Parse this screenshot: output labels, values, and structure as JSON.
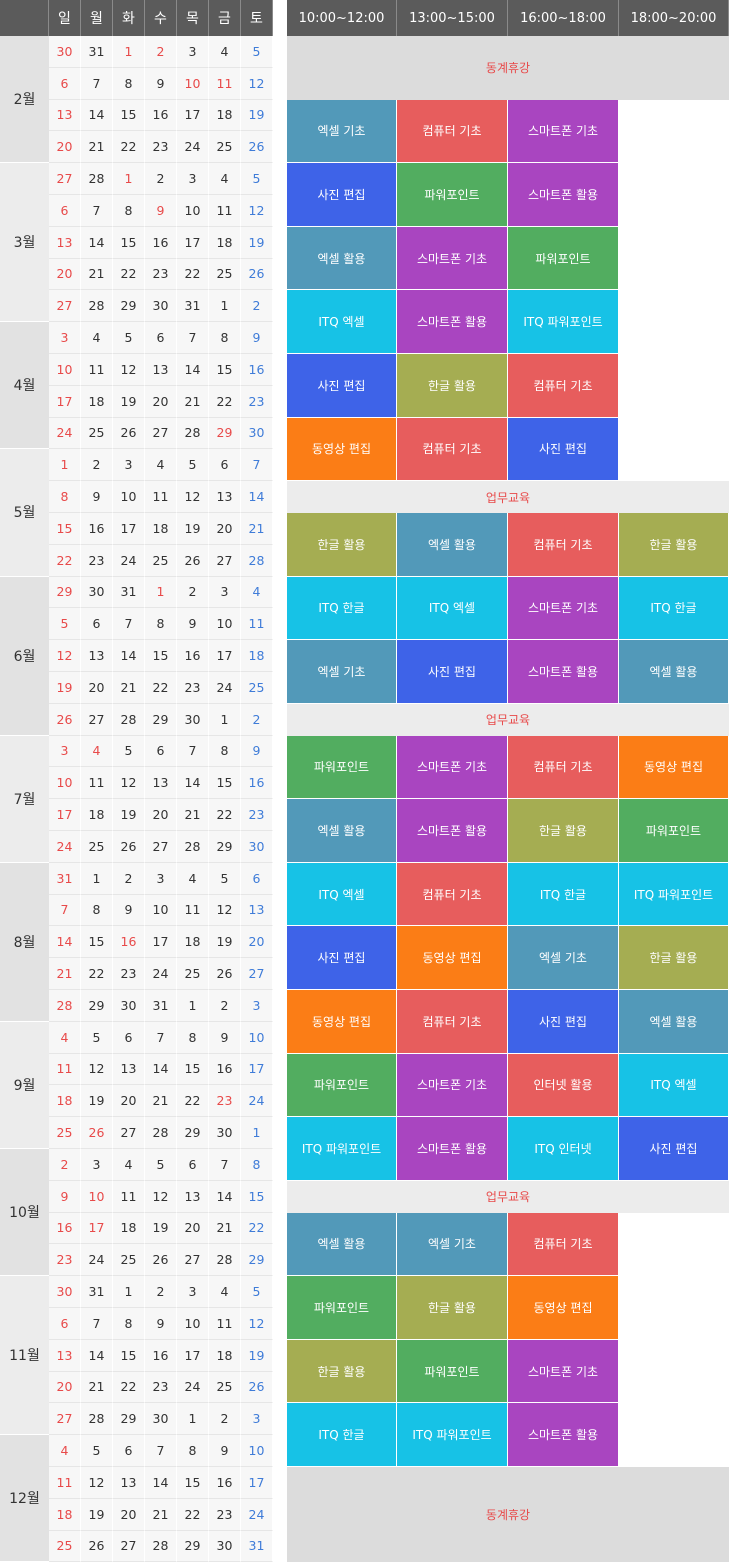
{
  "weekdays": [
    "일",
    "월",
    "화",
    "수",
    "목",
    "금",
    "토"
  ],
  "slots": [
    "10:00~12:00",
    "13:00~15:00",
    "16:00~18:00",
    "18:00~20:00"
  ],
  "colors": {
    "엑셀 기초": "#5299b9",
    "엑셀 활용": "#5299b9",
    "컴퓨터 기초": "#e75d5d",
    "인터넷 활용": "#e75d5d",
    "스마트폰 기초": "#a945c0",
    "스마트폰 활용": "#a945c0",
    "사진 편집": "#3e63e8",
    "파워포인트": "#52ad60",
    "ITQ 엑셀": "#17c2e6",
    "ITQ 파워포인트": "#17c2e6",
    "ITQ 한글": "#17c2e6",
    "ITQ 인터넷": "#17c2e6",
    "한글 활용": "#a5ad52",
    "동영상 편집": "#fb7d16"
  },
  "months": [
    {
      "label": "2월",
      "weeks": [
        [
          "30",
          "31",
          "1",
          "2",
          "3",
          "4",
          "5"
        ],
        [
          "6",
          "7",
          "8",
          "9",
          "10",
          "11",
          "12"
        ],
        [
          "13",
          "14",
          "15",
          "16",
          "17",
          "18",
          "19"
        ],
        [
          "20",
          "21",
          "22",
          "23",
          "24",
          "25",
          "26"
        ]
      ]
    },
    {
      "label": "3월",
      "weeks": [
        [
          "27",
          "28",
          "1",
          "2",
          "3",
          "4",
          "5"
        ],
        [
          "6",
          "7",
          "8",
          "9",
          "10",
          "11",
          "12"
        ],
        [
          "13",
          "14",
          "15",
          "16",
          "17",
          "18",
          "19"
        ],
        [
          "20",
          "21",
          "22",
          "23",
          "22",
          "25",
          "26"
        ],
        [
          "27",
          "28",
          "29",
          "30",
          "31",
          "1",
          "2"
        ]
      ]
    },
    {
      "label": "4월",
      "weeks": [
        [
          "3",
          "4",
          "5",
          "6",
          "7",
          "8",
          "9"
        ],
        [
          "10",
          "11",
          "12",
          "13",
          "14",
          "15",
          "16"
        ],
        [
          "17",
          "18",
          "19",
          "20",
          "21",
          "22",
          "23"
        ],
        [
          "24",
          "25",
          "26",
          "27",
          "28",
          "29",
          "30"
        ]
      ]
    },
    {
      "label": "5월",
      "weeks": [
        [
          "1",
          "2",
          "3",
          "4",
          "5",
          "6",
          "7"
        ],
        [
          "8",
          "9",
          "10",
          "11",
          "12",
          "13",
          "14"
        ],
        [
          "15",
          "16",
          "17",
          "18",
          "19",
          "20",
          "21"
        ],
        [
          "22",
          "23",
          "24",
          "25",
          "26",
          "27",
          "28"
        ]
      ]
    },
    {
      "label": "6월",
      "weeks": [
        [
          "29",
          "30",
          "31",
          "1",
          "2",
          "3",
          "4"
        ],
        [
          "5",
          "6",
          "7",
          "8",
          "9",
          "10",
          "11"
        ],
        [
          "12",
          "13",
          "14",
          "15",
          "16",
          "17",
          "18"
        ],
        [
          "19",
          "20",
          "21",
          "22",
          "23",
          "24",
          "25"
        ],
        [
          "26",
          "27",
          "28",
          "29",
          "30",
          "1",
          "2"
        ]
      ]
    },
    {
      "label": "7월",
      "weeks": [
        [
          "3",
          "4",
          "5",
          "6",
          "7",
          "8",
          "9"
        ],
        [
          "10",
          "11",
          "12",
          "13",
          "14",
          "15",
          "16"
        ],
        [
          "17",
          "18",
          "19",
          "20",
          "21",
          "22",
          "23"
        ],
        [
          "24",
          "25",
          "26",
          "27",
          "28",
          "29",
          "30"
        ]
      ]
    },
    {
      "label": "8월",
      "weeks": [
        [
          "31",
          "1",
          "2",
          "3",
          "4",
          "5",
          "6"
        ],
        [
          "7",
          "8",
          "9",
          "10",
          "11",
          "12",
          "13"
        ],
        [
          "14",
          "15",
          "16",
          "17",
          "18",
          "19",
          "20"
        ],
        [
          "21",
          "22",
          "23",
          "24",
          "25",
          "26",
          "27"
        ],
        [
          "28",
          "29",
          "30",
          "31",
          "1",
          "2",
          "3"
        ]
      ]
    },
    {
      "label": "9월",
      "weeks": [
        [
          "4",
          "5",
          "6",
          "7",
          "8",
          "9",
          "10"
        ],
        [
          "11",
          "12",
          "13",
          "14",
          "15",
          "16",
          "17"
        ],
        [
          "18",
          "19",
          "20",
          "21",
          "22",
          "23",
          "24"
        ],
        [
          "25",
          "26",
          "27",
          "28",
          "29",
          "30",
          "1"
        ]
      ]
    },
    {
      "label": "10월",
      "weeks": [
        [
          "2",
          "3",
          "4",
          "5",
          "6",
          "7",
          "8"
        ],
        [
          "9",
          "10",
          "11",
          "12",
          "13",
          "14",
          "15"
        ],
        [
          "16",
          "17",
          "18",
          "19",
          "20",
          "21",
          "22"
        ],
        [
          "23",
          "24",
          "25",
          "26",
          "27",
          "28",
          "29"
        ]
      ]
    },
    {
      "label": "11월",
      "weeks": [
        [
          "30",
          "31",
          "1",
          "2",
          "3",
          "4",
          "5"
        ],
        [
          "6",
          "7",
          "8",
          "9",
          "10",
          "11",
          "12"
        ],
        [
          "13",
          "14",
          "15",
          "16",
          "17",
          "18",
          "19"
        ],
        [
          "20",
          "21",
          "22",
          "23",
          "24",
          "25",
          "26"
        ],
        [
          "27",
          "28",
          "29",
          "30",
          "1",
          "2",
          "3"
        ]
      ]
    },
    {
      "label": "12월",
      "weeks": [
        [
          "4",
          "5",
          "6",
          "7",
          "8",
          "9",
          "10"
        ],
        [
          "11",
          "12",
          "13",
          "14",
          "15",
          "16",
          "17"
        ],
        [
          "18",
          "19",
          "20",
          "21",
          "22",
          "23",
          "24"
        ],
        [
          "25",
          "26",
          "27",
          "28",
          "29",
          "30",
          "31"
        ]
      ]
    }
  ],
  "holidays": [
    {
      "week": 0,
      "day": 2
    },
    {
      "week": 0,
      "day": 3
    },
    {
      "week": 1,
      "day": 4
    },
    {
      "week": 1,
      "day": 5
    },
    {
      "week": 4,
      "day": 2
    },
    {
      "week": 5,
      "day": 3
    },
    {
      "week": 12,
      "day": 5
    },
    {
      "week": 17,
      "day": 3
    },
    {
      "week": 22,
      "day": 1
    },
    {
      "week": 28,
      "day": 2
    },
    {
      "week": 33,
      "day": 5
    },
    {
      "week": 34,
      "day": 1
    },
    {
      "week": 36,
      "day": 1
    },
    {
      "week": 37,
      "day": 1
    }
  ],
  "schedule": [
    {
      "type": "note",
      "text": "동계휴강",
      "rows": 2
    },
    {
      "type": "row",
      "rows": 2,
      "classes": [
        "엑셀 기초",
        "컴퓨터 기초",
        "스마트폰 기초",
        ""
      ]
    },
    {
      "type": "row",
      "rows": 2,
      "classes": [
        "사진 편집",
        "파워포인트",
        "스마트폰 활용",
        ""
      ]
    },
    {
      "type": "row",
      "rows": 2,
      "classes": [
        "엑셀 활용",
        "스마트폰 기초",
        "파워포인트",
        ""
      ]
    },
    {
      "type": "row",
      "rows": 2,
      "classes": [
        "ITQ 엑셀",
        "스마트폰 활용",
        "ITQ 파워포인트",
        ""
      ]
    },
    {
      "type": "row",
      "rows": 2,
      "classes": [
        "사진 편집",
        "한글 활용",
        "컴퓨터 기초",
        ""
      ]
    },
    {
      "type": "row",
      "rows": 2,
      "classes": [
        "동영상 편집",
        "컴퓨터 기초",
        "사진 편집",
        ""
      ]
    },
    {
      "type": "note",
      "text": "업무교육",
      "rows": 1,
      "light": true
    },
    {
      "type": "row",
      "rows": 2,
      "classes": [
        "한글 활용",
        "엑셀 활용",
        "컴퓨터 기초",
        "한글 활용"
      ]
    },
    {
      "type": "row",
      "rows": 2,
      "classes": [
        "ITQ 한글",
        "ITQ 엑셀",
        "스마트폰 기초",
        "ITQ 한글"
      ]
    },
    {
      "type": "row",
      "rows": 2,
      "classes": [
        "엑셀 기초",
        "사진 편집",
        "스마트폰 활용",
        "엑셀 활용"
      ]
    },
    {
      "type": "note",
      "text": "업무교육",
      "rows": 1,
      "light": true
    },
    {
      "type": "row",
      "rows": 2,
      "classes": [
        "파워포인트",
        "스마트폰 기초",
        "컴퓨터 기초",
        "동영상 편집"
      ]
    },
    {
      "type": "row",
      "rows": 2,
      "classes": [
        "엑셀 활용",
        "스마트폰 활용",
        "한글 활용",
        "파워포인트"
      ]
    },
    {
      "type": "row",
      "rows": 2,
      "classes": [
        "ITQ 엑셀",
        "컴퓨터 기초",
        "ITQ 한글",
        "ITQ 파워포인트"
      ]
    },
    {
      "type": "row",
      "rows": 2,
      "classes": [
        "사진 편집",
        "동영상 편집",
        "엑셀 기초",
        "한글 활용"
      ]
    },
    {
      "type": "row",
      "rows": 2,
      "classes": [
        "동영상 편집",
        "컴퓨터 기초",
        "사진 편집",
        "엑셀 활용"
      ]
    },
    {
      "type": "row",
      "rows": 2,
      "classes": [
        "파워포인트",
        "스마트폰 기초",
        "인터넷 활용",
        "ITQ 엑셀"
      ]
    },
    {
      "type": "row",
      "rows": 2,
      "classes": [
        "ITQ 파워포인트",
        "스마트폰 활용",
        "ITQ 인터넷",
        "사진 편집"
      ]
    },
    {
      "type": "note",
      "text": "업무교육",
      "rows": 1,
      "light": true
    },
    {
      "type": "row",
      "rows": 2,
      "classes": [
        "엑셀 활용",
        "엑셀 기초",
        "컴퓨터 기초",
        ""
      ]
    },
    {
      "type": "row",
      "rows": 2,
      "classes": [
        "파워포인트",
        "한글 활용",
        "동영상 편집",
        ""
      ]
    },
    {
      "type": "row",
      "rows": 2,
      "classes": [
        "한글 활용",
        "파워포인트",
        "스마트폰 기초",
        ""
      ]
    },
    {
      "type": "row",
      "rows": 2,
      "classes": [
        "ITQ 한글",
        "ITQ 파워포인트",
        "스마트폰 활용",
        ""
      ]
    },
    {
      "type": "note",
      "text": "동계휴강",
      "rows": 3
    }
  ]
}
